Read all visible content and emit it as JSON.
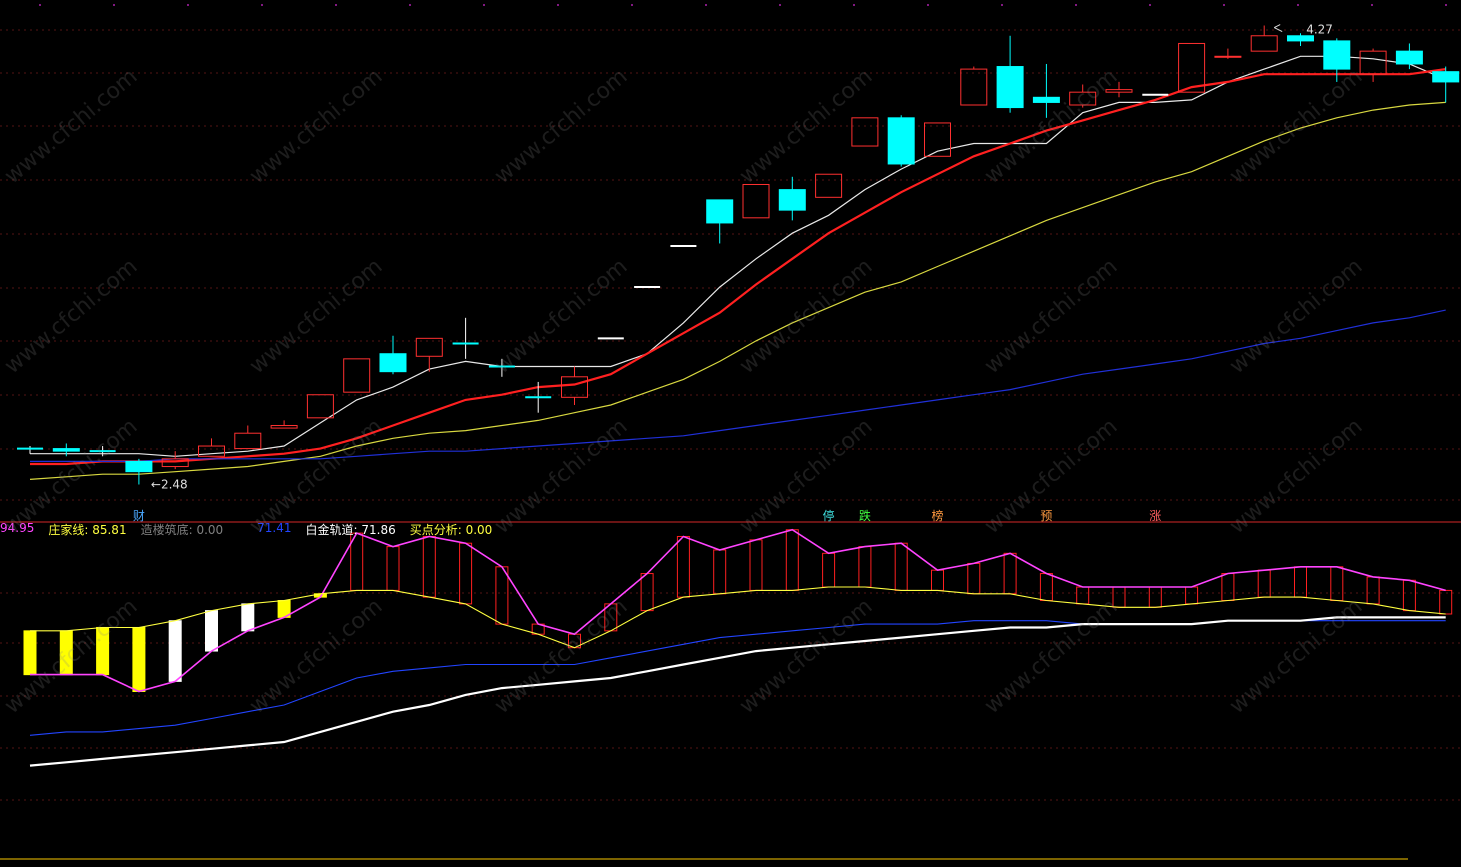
{
  "watermark": "www.cfchi.com",
  "price_labels": {
    "high": "4.27",
    "low": "2.48"
  },
  "indicator_bar": [
    {
      "label": "",
      "value": "94.95",
      "color": "#ff44ff"
    },
    {
      "label": "庄家线: ",
      "value": "85.81",
      "color": "#ffff40"
    },
    {
      "label": "造楼筑底: ",
      "value": "0.00",
      "color": "#808080"
    },
    {
      "label": "",
      "value": "71.41",
      "color": "#2244ff"
    },
    {
      "label": "白金轨道: ",
      "value": "71.86",
      "color": "#ffffff"
    },
    {
      "label": "买点分析: ",
      "value": "0.00",
      "color": "#ffff40"
    }
  ],
  "signals": [
    {
      "text": "财",
      "color": "#4aa8ff"
    },
    {
      "text": "停",
      "color": "#40e0e0"
    },
    {
      "text": "跌",
      "color": "#40ff40"
    },
    {
      "text": "榜",
      "color": "#ff9a40"
    },
    {
      "text": "预",
      "color": "#ff9a40"
    },
    {
      "text": "涨",
      "color": "#ff6060"
    }
  ],
  "chart_data": [
    {
      "type": "candlestick",
      "y_range": [
        2.4,
        4.35
      ],
      "gridlines": true,
      "candles": [
        {
          "o": 2.62,
          "h": 2.63,
          "l": 2.6,
          "c": 2.62,
          "up": false
        },
        {
          "o": 2.62,
          "h": 2.64,
          "l": 2.59,
          "c": 2.61,
          "up": false
        },
        {
          "o": 2.61,
          "h": 2.63,
          "l": 2.59,
          "c": 2.61,
          "up": false
        },
        {
          "o": 2.57,
          "h": 2.58,
          "l": 2.48,
          "c": 2.53,
          "up": false
        },
        {
          "o": 2.55,
          "h": 2.61,
          "l": 2.54,
          "c": 2.58,
          "up": true
        },
        {
          "o": 2.59,
          "h": 2.66,
          "l": 2.59,
          "c": 2.63,
          "up": true
        },
        {
          "o": 2.62,
          "h": 2.71,
          "l": 2.62,
          "c": 2.68,
          "up": true
        },
        {
          "o": 2.7,
          "h": 2.73,
          "l": 2.7,
          "c": 2.71,
          "up": true
        },
        {
          "o": 2.74,
          "h": 2.83,
          "l": 2.74,
          "c": 2.83,
          "up": true
        },
        {
          "o": 2.84,
          "h": 2.97,
          "l": 2.84,
          "c": 2.97,
          "up": true
        },
        {
          "o": 2.99,
          "h": 3.06,
          "l": 2.91,
          "c": 2.92,
          "up": false
        },
        {
          "o": 2.98,
          "h": 3.05,
          "l": 2.92,
          "c": 3.05,
          "up": true
        },
        {
          "o": 3.03,
          "h": 3.13,
          "l": 2.97,
          "c": 3.03,
          "up": false
        },
        {
          "o": 2.94,
          "h": 2.97,
          "l": 2.9,
          "c": 2.94,
          "up": false
        },
        {
          "o": 2.82,
          "h": 2.88,
          "l": 2.76,
          "c": 2.82,
          "up": false
        },
        {
          "o": 2.82,
          "h": 2.94,
          "l": 2.79,
          "c": 2.9,
          "up": true
        },
        {
          "o": 3.05,
          "h": 3.05,
          "l": 3.05,
          "c": 3.05,
          "up": false
        },
        {
          "o": 3.25,
          "h": 3.25,
          "l": 3.25,
          "c": 3.25,
          "up": false
        },
        {
          "o": 3.41,
          "h": 3.41,
          "l": 3.41,
          "c": 3.41,
          "up": false
        },
        {
          "o": 3.59,
          "h": 3.59,
          "l": 3.42,
          "c": 3.5,
          "up": false
        },
        {
          "o": 3.52,
          "h": 3.65,
          "l": 3.52,
          "c": 3.65,
          "up": true
        },
        {
          "o": 3.63,
          "h": 3.68,
          "l": 3.51,
          "c": 3.55,
          "up": false
        },
        {
          "o": 3.6,
          "h": 3.69,
          "l": 3.6,
          "c": 3.69,
          "up": true
        },
        {
          "o": 3.8,
          "h": 3.91,
          "l": 3.8,
          "c": 3.91,
          "up": true
        },
        {
          "o": 3.91,
          "h": 3.92,
          "l": 3.72,
          "c": 3.73,
          "up": false
        },
        {
          "o": 3.76,
          "h": 3.89,
          "l": 3.76,
          "c": 3.89,
          "up": true
        },
        {
          "o": 3.96,
          "h": 4.11,
          "l": 3.96,
          "c": 4.1,
          "up": true
        },
        {
          "o": 4.11,
          "h": 4.23,
          "l": 3.93,
          "c": 3.95,
          "up": false
        },
        {
          "o": 3.99,
          "h": 4.12,
          "l": 3.91,
          "c": 3.97,
          "up": false
        },
        {
          "o": 3.96,
          "h": 4.04,
          "l": 3.95,
          "c": 4.01,
          "up": true
        },
        {
          "o": 4.01,
          "h": 4.05,
          "l": 3.99,
          "c": 4.02,
          "up": true
        },
        {
          "o": 4.0,
          "h": 4.0,
          "l": 4.0,
          "c": 4.0,
          "up": false
        },
        {
          "o": 4.01,
          "h": 4.2,
          "l": 4.01,
          "c": 4.2,
          "up": true
        },
        {
          "o": 4.15,
          "h": 4.18,
          "l": 4.14,
          "c": 4.15,
          "up": true
        },
        {
          "o": 4.17,
          "h": 4.27,
          "l": 4.17,
          "c": 4.23,
          "up": true
        },
        {
          "o": 4.21,
          "h": 4.24,
          "l": 4.19,
          "c": 4.23,
          "up": false
        },
        {
          "o": 4.21,
          "h": 4.22,
          "l": 4.05,
          "c": 4.1,
          "up": false
        },
        {
          "o": 4.08,
          "h": 4.18,
          "l": 4.05,
          "c": 4.17,
          "up": true
        },
        {
          "o": 4.17,
          "h": 4.2,
          "l": 4.1,
          "c": 4.12,
          "up": false
        },
        {
          "o": 4.09,
          "h": 4.11,
          "l": 3.97,
          "c": 4.05,
          "up": false
        }
      ],
      "series": [
        {
          "name": "",
          "color": "#e8e8e8",
          "values": [
            2.6,
            2.6,
            2.6,
            2.6,
            2.59,
            2.6,
            2.61,
            2.63,
            2.72,
            2.81,
            2.86,
            2.93,
            2.96,
            2.94,
            2.94,
            2.94,
            2.94,
            2.99,
            3.11,
            3.25,
            3.36,
            3.46,
            3.53,
            3.63,
            3.71,
            3.78,
            3.81,
            3.81,
            3.81,
            3.93,
            3.97,
            3.97,
            3.98,
            4.05,
            4.1,
            4.15,
            4.15,
            4.14,
            4.12,
            4.06
          ]
        },
        {
          "name": "",
          "color": "#ff2020",
          "values": [
            2.56,
            2.56,
            2.57,
            2.57,
            2.57,
            2.58,
            2.59,
            2.6,
            2.62,
            2.66,
            2.71,
            2.76,
            2.81,
            2.83,
            2.86,
            2.87,
            2.91,
            2.99,
            3.07,
            3.15,
            3.26,
            3.36,
            3.46,
            3.54,
            3.62,
            3.69,
            3.76,
            3.81,
            3.86,
            3.9,
            3.94,
            3.98,
            4.03,
            4.05,
            4.08,
            4.08,
            4.08,
            4.08,
            4.08,
            4.1
          ]
        },
        {
          "name": "",
          "color": "#d8d840",
          "values": [
            2.5,
            2.51,
            2.52,
            2.52,
            2.53,
            2.54,
            2.55,
            2.57,
            2.59,
            2.63,
            2.66,
            2.68,
            2.69,
            2.71,
            2.73,
            2.76,
            2.79,
            2.84,
            2.89,
            2.96,
            3.04,
            3.11,
            3.17,
            3.23,
            3.27,
            3.33,
            3.39,
            3.45,
            3.51,
            3.56,
            3.61,
            3.66,
            3.7,
            3.76,
            3.82,
            3.87,
            3.91,
            3.94,
            3.96,
            3.97
          ]
        },
        {
          "name": "",
          "color": "#2030d8",
          "values": [
            2.57,
            2.57,
            2.57,
            2.57,
            2.58,
            2.58,
            2.58,
            2.58,
            2.58,
            2.59,
            2.6,
            2.61,
            2.61,
            2.62,
            2.63,
            2.64,
            2.65,
            2.66,
            2.67,
            2.69,
            2.71,
            2.73,
            2.75,
            2.77,
            2.79,
            2.81,
            2.83,
            2.85,
            2.88,
            2.91,
            2.93,
            2.95,
            2.97,
            3.0,
            3.03,
            3.05,
            3.08,
            3.11,
            3.13,
            3.16
          ]
        }
      ]
    },
    {
      "type": "indicator",
      "y_range": [
        0,
        100
      ],
      "series": [
        {
          "name": "",
          "color": "#ff44ff",
          "values": [
            55,
            55,
            55,
            50,
            53,
            62,
            68,
            72,
            78,
            97,
            93,
            96,
            94,
            87,
            70,
            67,
            76,
            85,
            96,
            92,
            95,
            98,
            91,
            93,
            94,
            86,
            88,
            91,
            85,
            81,
            81,
            81,
            81,
            85,
            86,
            87,
            87,
            84,
            83,
            80
          ]
        },
        {
          "name": "",
          "color": "#ffff40",
          "values": [
            68,
            68,
            69,
            69,
            71,
            74,
            76,
            77,
            79,
            80,
            80,
            78,
            76,
            70,
            67,
            63,
            68,
            74,
            78,
            79,
            80,
            80,
            81,
            81,
            80,
            80,
            79,
            79,
            77,
            76,
            75,
            75,
            76,
            77,
            78,
            78,
            77,
            76,
            74,
            73
          ]
        },
        {
          "name": "",
          "color": "#2244ff",
          "values": [
            37,
            38,
            38,
            39,
            40,
            42,
            44,
            46,
            50,
            54,
            56,
            57,
            58,
            58,
            58,
            58,
            60,
            62,
            64,
            66,
            67,
            68,
            69,
            70,
            70,
            70,
            71,
            71,
            71,
            70,
            70,
            70,
            70,
            71,
            71,
            71,
            71,
            71,
            71,
            71
          ]
        },
        {
          "name": "",
          "color": "#ffffff",
          "values": [
            28,
            29,
            30,
            31,
            32,
            33,
            34,
            35,
            38,
            41,
            44,
            46,
            49,
            51,
            52,
            53,
            54,
            56,
            58,
            60,
            62,
            63,
            64,
            65,
            66,
            67,
            68,
            69,
            69,
            70,
            70,
            70,
            70,
            71,
            71,
            71,
            72,
            72,
            72,
            72
          ]
        }
      ]
    }
  ]
}
